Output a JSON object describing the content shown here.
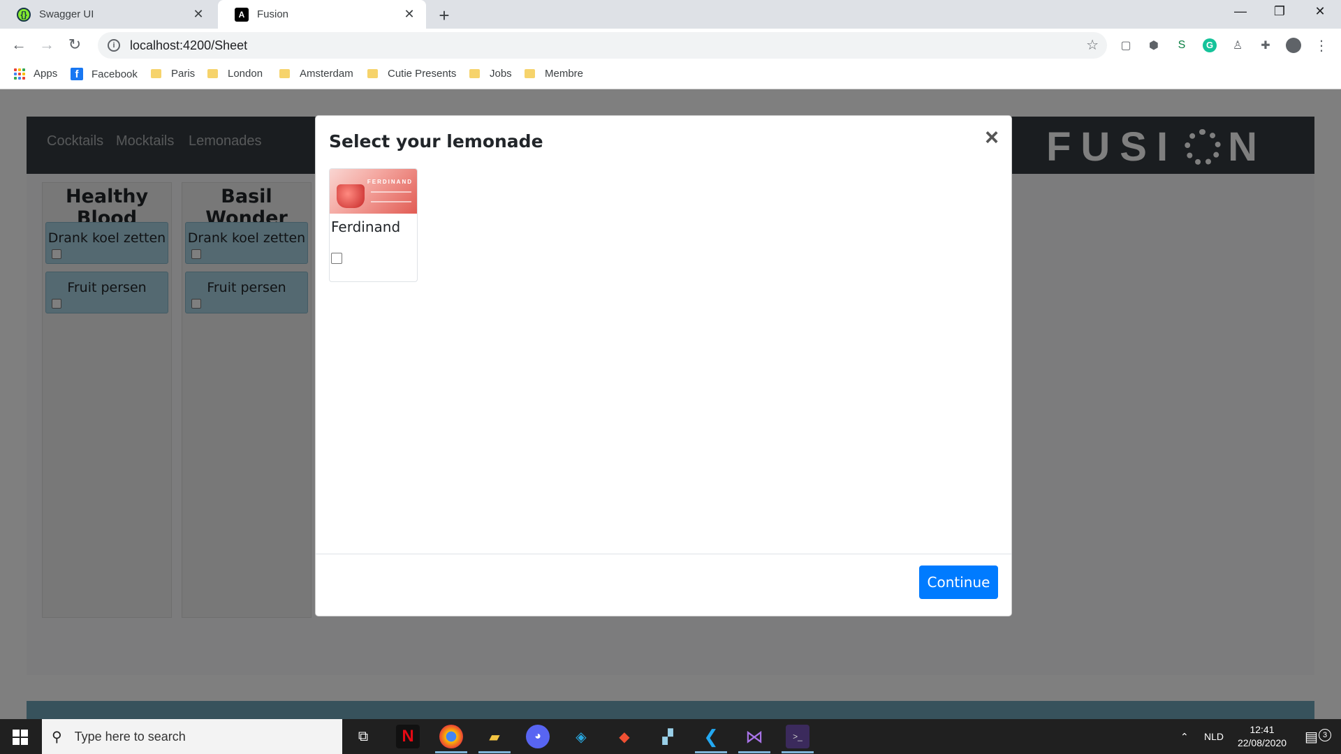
{
  "browser": {
    "tabs": [
      {
        "title": "Swagger UI",
        "icon": "swagger-icon",
        "active": false
      },
      {
        "title": "Fusion",
        "icon": "angular-icon",
        "active": true
      }
    ],
    "url": "localhost:4200/Sheet",
    "bookmarks": [
      {
        "label": "Apps",
        "icon": "apps-grid-icon"
      },
      {
        "label": "Facebook",
        "icon": "facebook-icon"
      },
      {
        "label": "Paris",
        "icon": "folder-icon"
      },
      {
        "label": "London",
        "icon": "folder-icon"
      },
      {
        "label": "Amsterdam",
        "icon": "folder-icon"
      },
      {
        "label": "Cutie Presents",
        "icon": "folder-icon"
      },
      {
        "label": "Jobs",
        "icon": "folder-icon"
      },
      {
        "label": "Membre",
        "icon": "folder-icon"
      }
    ]
  },
  "app": {
    "nav": [
      "Cocktails",
      "Mocktails",
      "Lemonades"
    ],
    "logo": "FUSI N",
    "columns": [
      {
        "title": "Healthy Blood",
        "tasks": [
          "Drank koel zetten",
          "Fruit persen"
        ]
      },
      {
        "title": "Basil Wonder",
        "tasks": [
          "Drank koel zetten",
          "Fruit persen"
        ]
      }
    ]
  },
  "modal": {
    "title": "Select your lemonade",
    "close": "×",
    "items": [
      {
        "name": "Ferdinand",
        "checked": false,
        "image_brand_text": "FERDINAND"
      }
    ],
    "continue_label": "Continue"
  },
  "taskbar": {
    "search_placeholder": "Type here to search",
    "language": "NLD",
    "time": "12:41",
    "date": "22/08/2020",
    "notifications": "3"
  },
  "colors": {
    "primary": "#007bff",
    "navbar": "#343a40",
    "task_card": "#a8d2e3"
  }
}
